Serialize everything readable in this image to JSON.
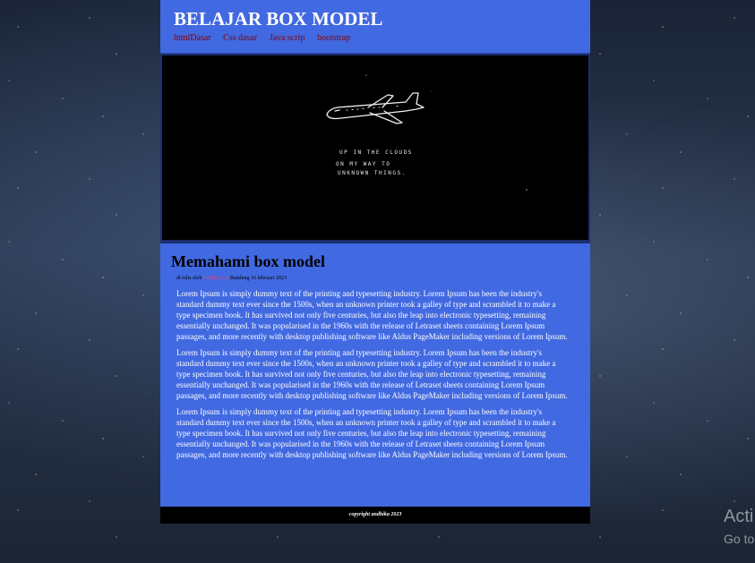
{
  "header": {
    "title": "BELAJAR BOX MODEL",
    "nav": [
      "htmlDasar",
      "Css dasar",
      "Java scrip",
      "bootstrap"
    ]
  },
  "hero": {
    "caption_lines": [
      "UP IN THE CLOUDS",
      "ON MY WAY TO",
      "UNKNOWN THINGS."
    ]
  },
  "article": {
    "title": "Memahami box model",
    "meta_prefix": "di tulis oleh",
    "meta_author": "Andhika Lp",
    "meta_suffix": "Bandung 16 februari 2023",
    "paragraphs": [
      "Lorem Ipsum is simply dummy text of the printing and typesetting industry. Lorem Ipsum has been the industry's standard dummy text ever since the 1500s, when an unknown printer took a galley of type and scrambled it to make a type specimen book. It has survived not only five centuries, but also the leap into electronic typesetting, remaining essentially unchanged. It was popularised in the 1960s with the release of Letraset sheets containing Lorem Ipsum passages, and more recently with desktop publishing software like Aldus PageMaker including versions of Lorem Ipsum.",
      "Lorem Ipsum is simply dummy text of the printing and typesetting industry. Lorem Ipsum has been the industry's standard dummy text ever since the 1500s, when an unknown printer took a galley of type and scrambled it to make a type specimen book. It has survived not only five centuries, but also the leap into electronic typesetting, remaining essentially unchanged. It was popularised in the 1960s with the release of Letraset sheets containing Lorem Ipsum passages, and more recently with desktop publishing software like Aldus PageMaker including versions of Lorem Ipsum.",
      "Lorem Ipsum is simply dummy text of the printing and typesetting industry. Lorem Ipsum has been the industry's standard dummy text ever since the 1500s, when an unknown printer took a galley of type and scrambled it to make a type specimen book. It has survived not only five centuries, but also the leap into electronic typesetting, remaining essentially unchanged. It was popularised in the 1960s with the release of Letraset sheets containing Lorem Ipsum passages, and more recently with desktop publishing software like Aldus PageMaker including versions of Lorem Ipsum."
    ]
  },
  "footer": {
    "text": "copyright andhika 2023"
  },
  "watermark": {
    "line1": "Acti",
    "line2": "Go to"
  },
  "colors": {
    "primary": "#4169e1",
    "nav_link": "#8b0000",
    "author": "#ff3366",
    "footer_bg": "#000000"
  }
}
